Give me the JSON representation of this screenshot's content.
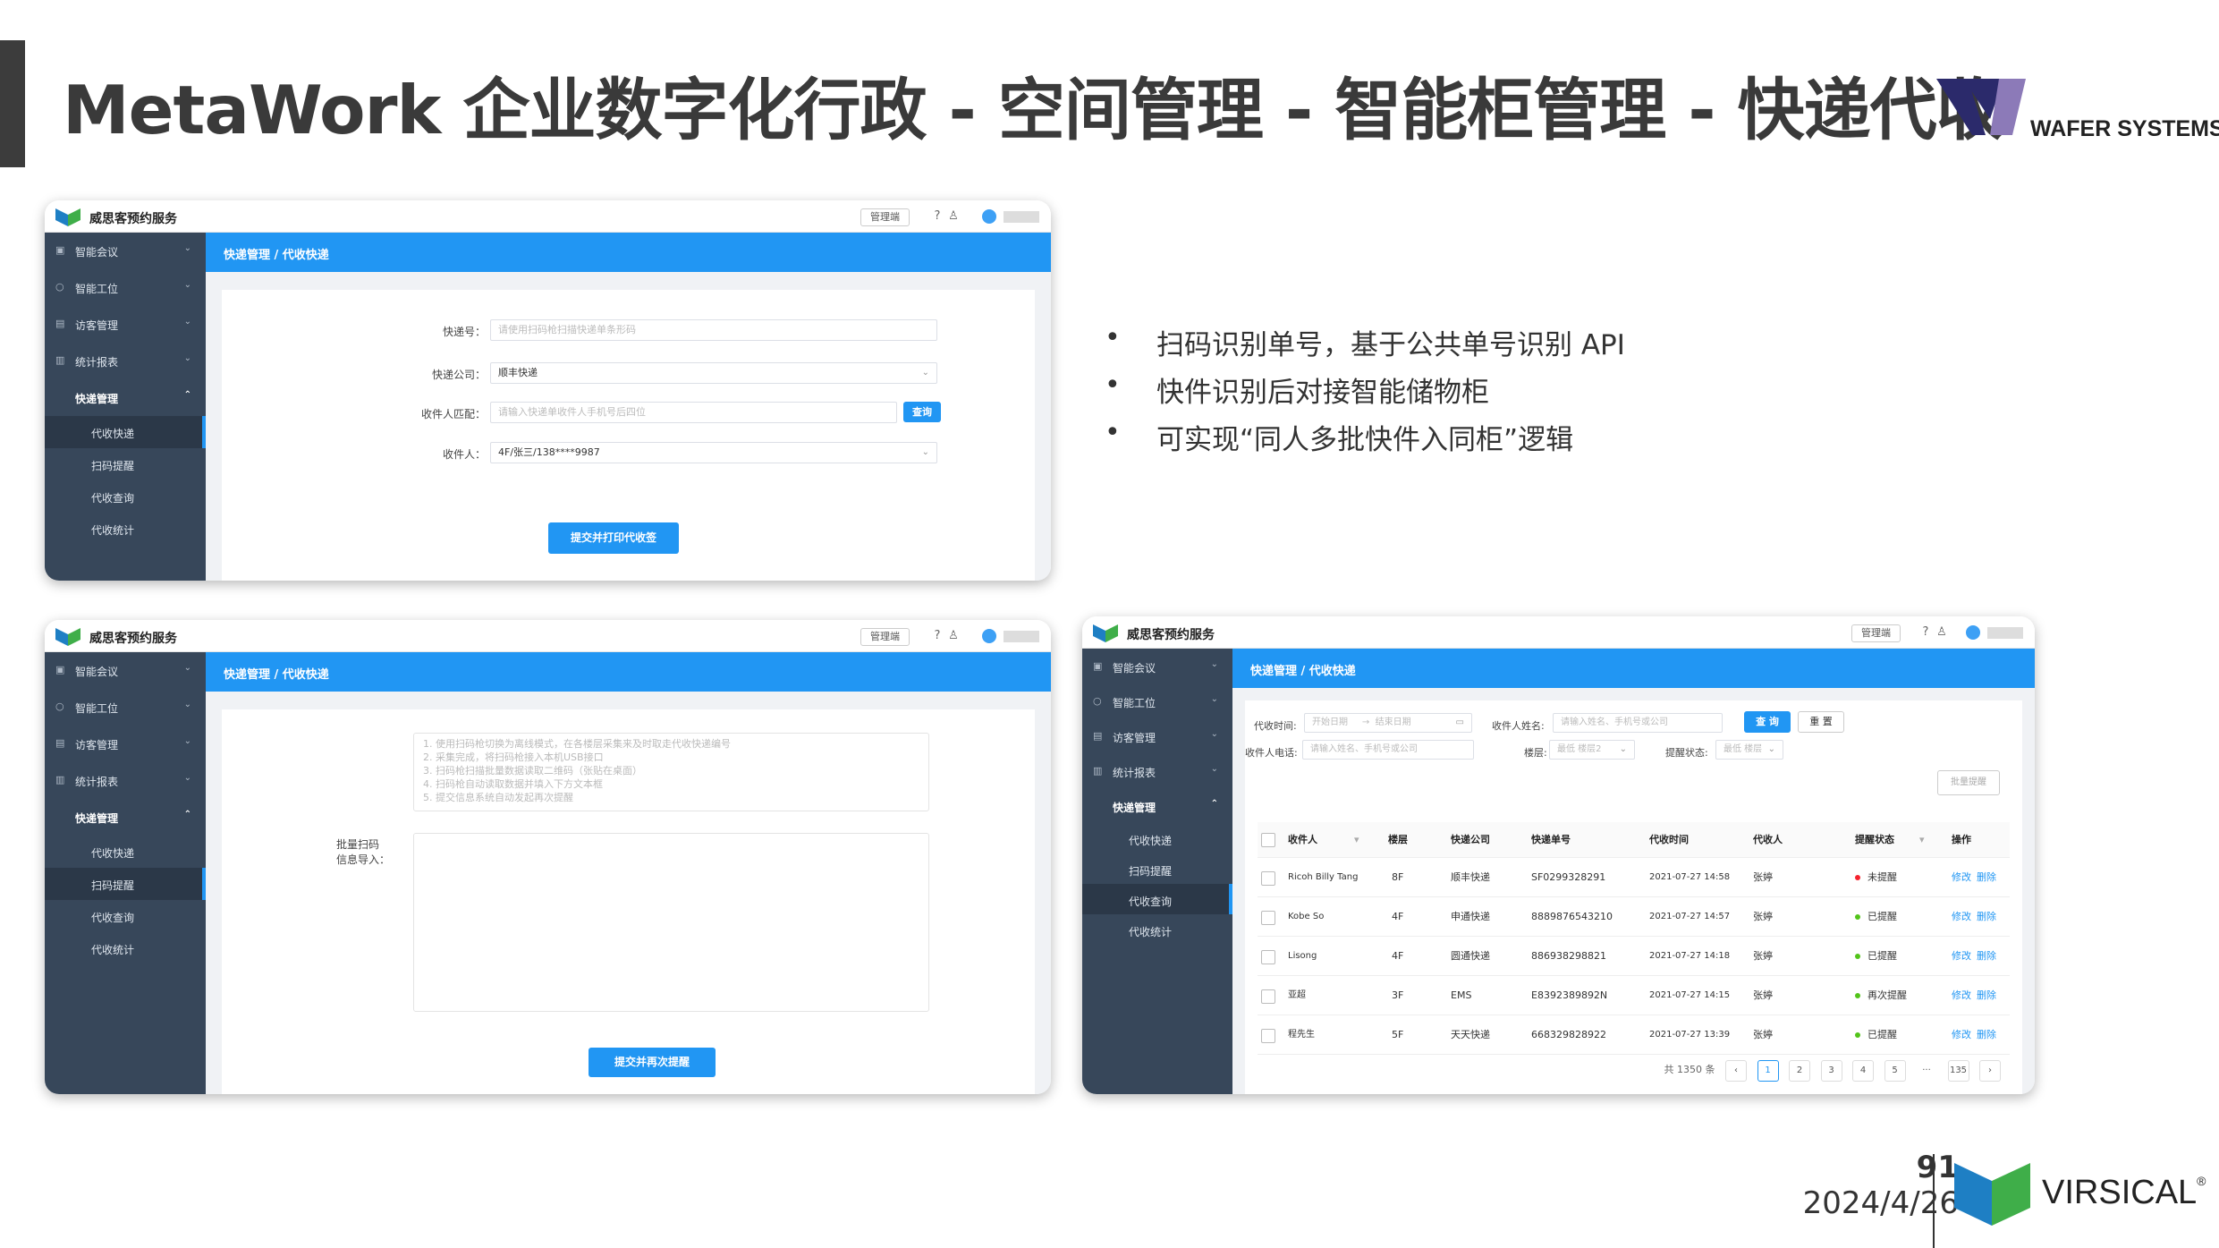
{
  "slide": {
    "title": "MetaWork 企业数字化行政 - 空间管理 - 智能柜管理 - 快递代收",
    "bullets": [
      "扫码识别单号，基于公共单号识别 API",
      "快件识别后对接智能储物柜",
      "可实现“同人多批快件入同柜”逻辑"
    ],
    "page_number": "91",
    "date": "2024/4/26"
  },
  "brands": {
    "wafer_text": "WAFER SYSTEMS",
    "virsical_text": "VIRSICAL",
    "virsical_reg": "®",
    "colors": {
      "wafer_navy": "#2b2a6b",
      "wafer_purple": "#8c7ab8",
      "virsical_blue": "#1e7fc4",
      "virsical_green": "#3fae49",
      "app_blue": "#2196f3",
      "sidebar": "#37475a"
    }
  },
  "app": {
    "brand_name": "威思客预约服务",
    "admin_label": "管理端",
    "help_icon": "question-circle-icon",
    "skin_icon": "tshirt-icon",
    "menu": [
      "智能会议",
      "智能工位",
      "访客管理",
      "统计报表"
    ],
    "menu_icons": [
      "calendar-icon",
      "desk-icon",
      "visitor-icon",
      "chart-icon"
    ],
    "group": "快递管理",
    "sub_menu": [
      "代收快递",
      "扫码提醒",
      "代收查询",
      "代收统计"
    ],
    "breadcrumb": "快递管理 / 代收快递"
  },
  "screen1": {
    "tracking_label": "快递号：",
    "tracking_placeholder": "请使用扫码枪扫描快递单条形码",
    "company_label": "快递公司：",
    "company_value": "顺丰快递",
    "match_label": "收件人匹配：",
    "match_placeholder": "请输入快递单收件人手机号后四位",
    "query_button": "查询",
    "recipient_label": "收件人：",
    "recipient_value": "4F/张三/138****9987",
    "submit_button": "提交并打印代收签"
  },
  "screen2": {
    "instructions": [
      "1.  使用扫码枪切换为离线模式，在各楼层采集来及时取走代收快递编号",
      "2.  采集完成，将扫码枪接入本机USB接口",
      "3.  扫码枪扫描批量数据读取二维码（张贴在桌面）",
      "4.  扫码枪自动读取数据并填入下方文本框",
      "5.  提交信息系统自动发起再次提醒"
    ],
    "batch_label_1": "批量扫码",
    "batch_label_2": "信息导入：",
    "submit_button": "提交并再次提醒"
  },
  "screen3": {
    "time_label": "代收时间:",
    "start_placeholder": "开始日期",
    "range_sep": "→",
    "end_placeholder": "结束日期",
    "name_label": "收件人姓名:",
    "name_placeholder": "请输入姓名、手机号或公司",
    "phone_label": "收件人电话:",
    "phone_placeholder": "请输入姓名、手机号或公司",
    "floor_label": "楼层:",
    "floor_placeholder": "最低 楼层2",
    "status_label": "提醒状态:",
    "status_placeholder": "最低 楼层",
    "search_button": "查 询",
    "reset_button": "重 置",
    "batch_button": "批量提醒",
    "columns": [
      "收件人",
      "楼层",
      "快递公司",
      "快递单号",
      "代收时间",
      "代收人",
      "提醒状态",
      "操作"
    ],
    "rows": [
      {
        "name": "Ricoh Billy Tang",
        "floor": "8F",
        "company": "顺丰快递",
        "number": "SF0299328291",
        "time": "2021-07-27 14:58",
        "agent": "张婷",
        "status": "未提醒",
        "status_color": "#f5222d"
      },
      {
        "name": "Kobe So",
        "floor": "4F",
        "company": "申通快递",
        "number": "8889876543210",
        "time": "2021-07-27 14:57",
        "agent": "张婷",
        "status": "已提醒",
        "status_color": "#52c41a"
      },
      {
        "name": "Lisong",
        "floor": "4F",
        "company": "圆通快递",
        "number": "886938298821",
        "time": "2021-07-27 14:18",
        "agent": "张婷",
        "status": "已提醒",
        "status_color": "#52c41a"
      },
      {
        "name": "亚超",
        "floor": "3F",
        "company": "EMS",
        "number": "E8392389892N",
        "time": "2021-07-27 14:15",
        "agent": "张婷",
        "status": "再次提醒",
        "status_color": "#52c41a"
      },
      {
        "name": "程先生",
        "floor": "5F",
        "company": "天天快递",
        "number": "668329828922",
        "time": "2021-07-27 13:39",
        "agent": "张婷",
        "status": "已提醒",
        "status_color": "#52c41a"
      }
    ],
    "edit_label": "修改",
    "delete_label": "删除",
    "total_text": "共 1350 条",
    "pages": [
      "1",
      "2",
      "3",
      "4",
      "5",
      "···",
      "135"
    ],
    "prev": "‹",
    "next": "›"
  }
}
